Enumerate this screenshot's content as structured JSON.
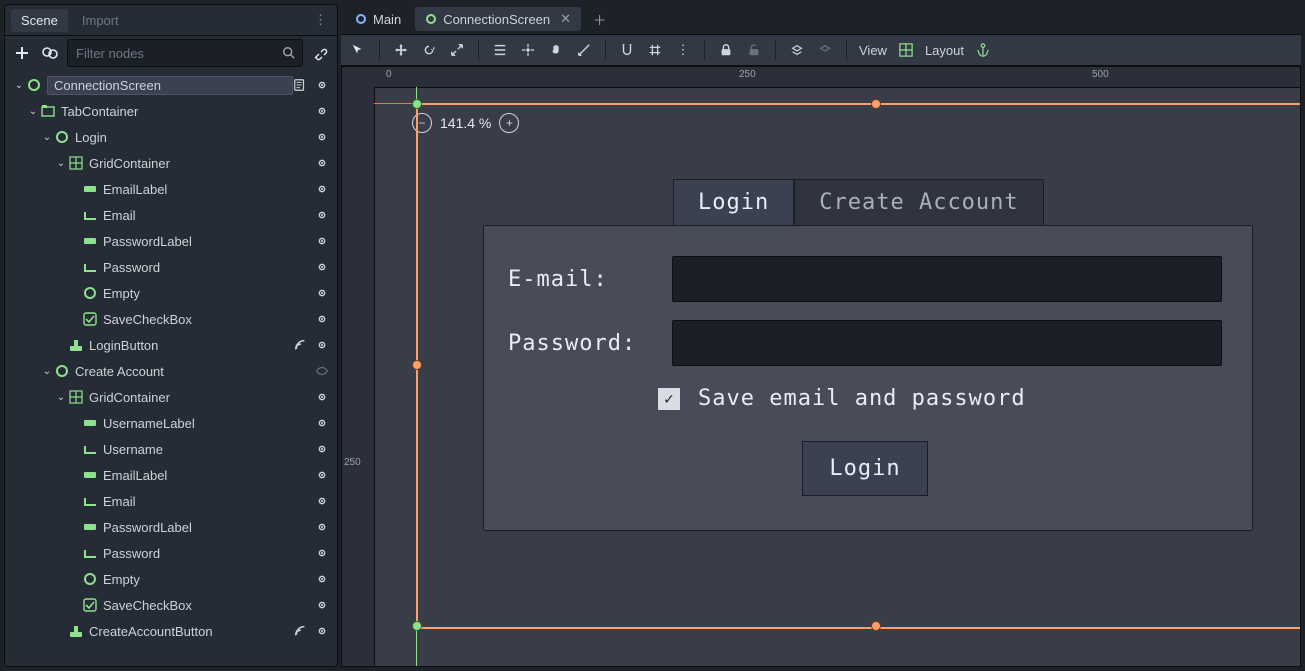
{
  "dock": {
    "scene_tab": "Scene",
    "import_tab": "Import"
  },
  "filter": {
    "placeholder": "Filter nodes"
  },
  "tree": [
    {
      "d": 0,
      "c": 1,
      "icon": "ctrl",
      "name": "ConnectionScreen",
      "sel": 1,
      "script": 1,
      "eye": 1
    },
    {
      "d": 1,
      "c": 1,
      "icon": "tabc",
      "name": "TabContainer",
      "eye": 1
    },
    {
      "d": 2,
      "c": 1,
      "icon": "ctrl",
      "name": "Login",
      "eye": 1
    },
    {
      "d": 3,
      "c": 1,
      "icon": "grid",
      "name": "GridContainer",
      "eye": 1
    },
    {
      "d": 4,
      "c": 0,
      "icon": "label",
      "name": "EmailLabel",
      "eye": 1
    },
    {
      "d": 4,
      "c": 0,
      "icon": "line",
      "name": "Email",
      "eye": 1
    },
    {
      "d": 4,
      "c": 0,
      "icon": "label",
      "name": "PasswordLabel",
      "eye": 1
    },
    {
      "d": 4,
      "c": 0,
      "icon": "line",
      "name": "Password",
      "eye": 1
    },
    {
      "d": 4,
      "c": 0,
      "icon": "ctrl",
      "name": "Empty",
      "eye": 1
    },
    {
      "d": 4,
      "c": 0,
      "icon": "check",
      "name": "SaveCheckBox",
      "eye": 1
    },
    {
      "d": 3,
      "c": 0,
      "icon": "btn",
      "name": "LoginButton",
      "sig": 1,
      "eye": 1
    },
    {
      "d": 2,
      "c": 1,
      "icon": "ctrl",
      "name": "Create Account",
      "eye": 1,
      "dim": 1
    },
    {
      "d": 3,
      "c": 1,
      "icon": "grid",
      "name": "GridContainer",
      "eye": 1
    },
    {
      "d": 4,
      "c": 0,
      "icon": "label",
      "name": "UsernameLabel",
      "eye": 1
    },
    {
      "d": 4,
      "c": 0,
      "icon": "line",
      "name": "Username",
      "eye": 1
    },
    {
      "d": 4,
      "c": 0,
      "icon": "label",
      "name": "EmailLabel",
      "eye": 1
    },
    {
      "d": 4,
      "c": 0,
      "icon": "line",
      "name": "Email",
      "eye": 1
    },
    {
      "d": 4,
      "c": 0,
      "icon": "label",
      "name": "PasswordLabel",
      "eye": 1
    },
    {
      "d": 4,
      "c": 0,
      "icon": "line",
      "name": "Password",
      "eye": 1
    },
    {
      "d": 4,
      "c": 0,
      "icon": "ctrl",
      "name": "Empty",
      "eye": 1
    },
    {
      "d": 4,
      "c": 0,
      "icon": "check",
      "name": "SaveCheckBox",
      "eye": 1
    },
    {
      "d": 3,
      "c": 0,
      "icon": "btn",
      "name": "CreateAccountButton",
      "sig": 1,
      "eye": 1
    }
  ],
  "editor_tabs": {
    "main": "Main",
    "conn": "ConnectionScreen"
  },
  "ruler": {
    "h250": "250",
    "h500": "500",
    "v250": "250",
    "h0": "0"
  },
  "zoom": {
    "pct": "141.4 %"
  },
  "toolbar": {
    "view": "View",
    "layout": "Layout"
  },
  "form": {
    "tab_login": "Login",
    "tab_create": "Create Account",
    "email_label": "E-mail:",
    "password_label": "Password:",
    "save_label": "Save email and password",
    "login_btn": "Login",
    "checked": "✓"
  }
}
